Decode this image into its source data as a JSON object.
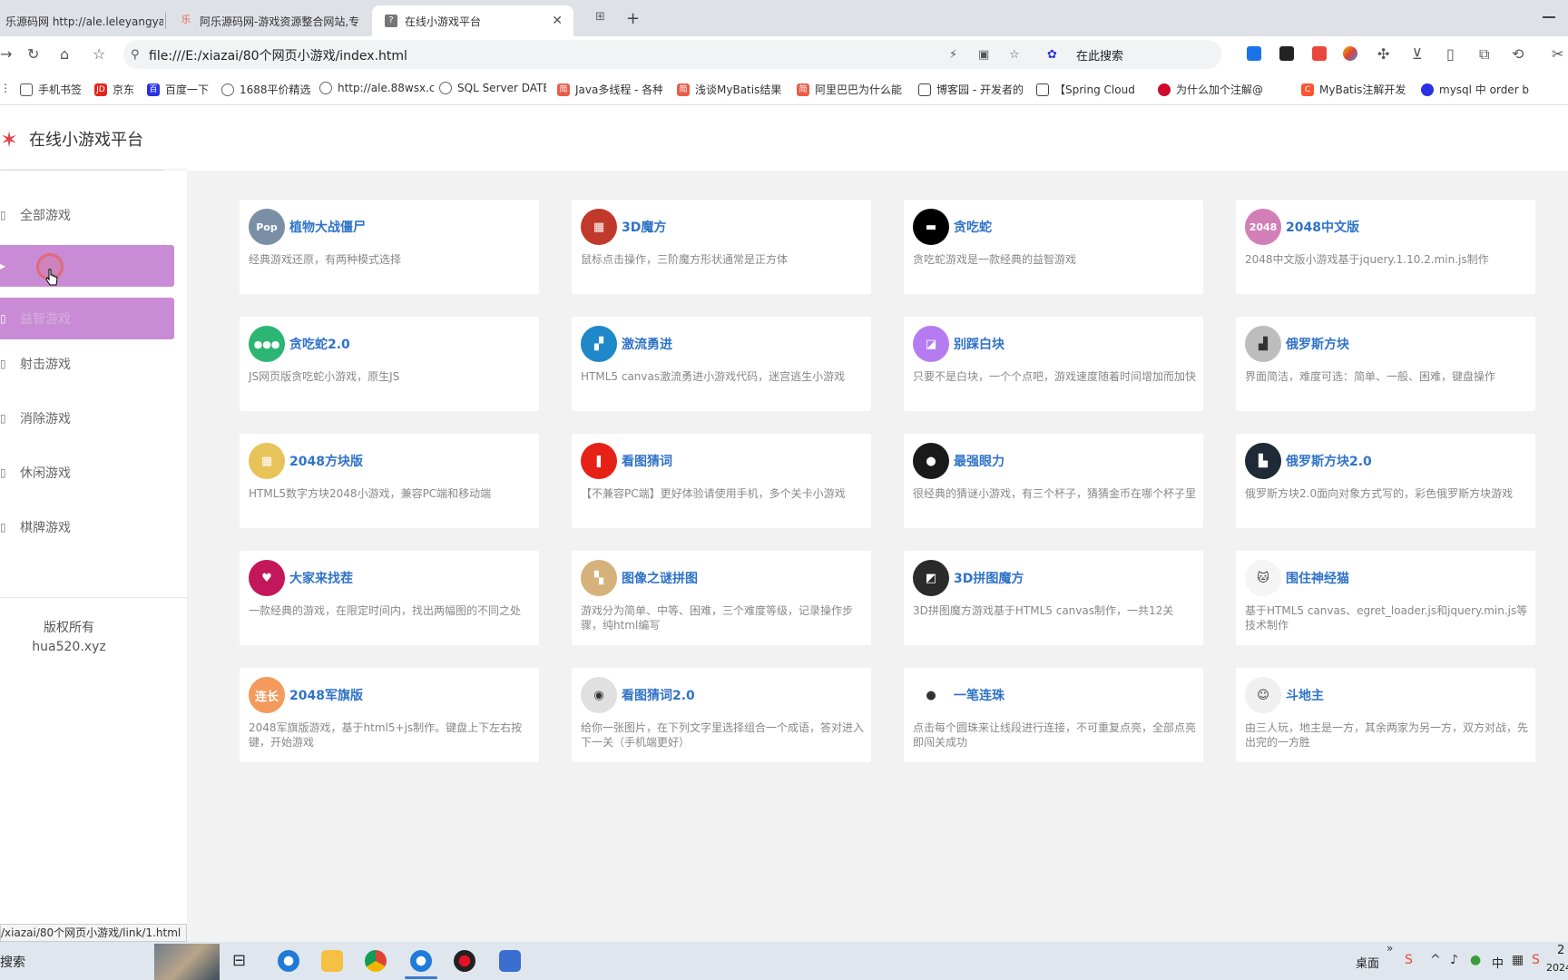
{
  "browser": {
    "tabs": [
      {
        "label": "乐源码网 http://ale.leleyangya"
      },
      {
        "label": "阿乐源码网-游戏资源整合网站,专"
      },
      {
        "label": "在线小游戏平台",
        "close": "✕"
      }
    ],
    "new_tab": "+",
    "address": "file:///E:/xiazai/80个网页小游戏/index.html",
    "search_placeholder": "在此搜索",
    "bookmarks": [
      {
        "label": "手机书签",
        "color": "#ffffff",
        "mark": ""
      },
      {
        "label": "京东",
        "color": "#e1251b",
        "mark": "JD"
      },
      {
        "label": "百度一下",
        "color": "#2932e1",
        "mark": "百"
      },
      {
        "label": "1688平价精选",
        "color": "#666666",
        "mark": ""
      },
      {
        "label": "http://ale.88wsx.c",
        "color": "#666666",
        "mark": ""
      },
      {
        "label": "SQL Server DATE",
        "color": "#666666",
        "mark": ""
      },
      {
        "label": "Java多线程 - 各种",
        "color": "#e85d4a",
        "mark": "简"
      },
      {
        "label": "浅谈MyBatis结果",
        "color": "#e85d4a",
        "mark": "简"
      },
      {
        "label": "阿里巴巴为什么能",
        "color": "#e85d4a",
        "mark": "简"
      },
      {
        "label": "博客园 - 开发者的",
        "color": "#444444",
        "mark": ""
      },
      {
        "label": "【Spring Cloud",
        "color": "#444444",
        "mark": ""
      },
      {
        "label": "为什么加个注解@",
        "color": "#cf0a2c",
        "mark": ""
      },
      {
        "label": "MyBatis注解开发",
        "color": "#fc5531",
        "mark": "C"
      },
      {
        "label": "mysql 中 order b",
        "color": "#2932e1",
        "mark": ""
      }
    ]
  },
  "site": {
    "title": "在线小游戏平台",
    "nav": [
      {
        "label": "全部游戏",
        "icon": "▯"
      },
      {
        "label": "",
        "icon": "▸"
      },
      {
        "label": "益智游戏",
        "icon": "▯"
      },
      {
        "label": "射击游戏",
        "icon": "▯"
      },
      {
        "label": "消除游戏",
        "icon": "▯"
      },
      {
        "label": "休闲游戏",
        "icon": "▯"
      },
      {
        "label": "棋牌游戏",
        "icon": "▯"
      }
    ],
    "copyright": "版权所有",
    "domain": "hua520.xyz"
  },
  "games": [
    {
      "name": "植物大战僵尸",
      "desc": "经典游戏还原，有两种模式选择",
      "color": "#7a8fa6",
      "mark": "Pop"
    },
    {
      "name": "3D魔方",
      "desc": "鼠标点击操作，三阶魔方形状通常是正方体",
      "color": "#c0392b",
      "mark": "▦"
    },
    {
      "name": "贪吃蛇",
      "desc": "贪吃蛇游戏是一款经典的益智游戏",
      "color": "#000000",
      "mark": "▬"
    },
    {
      "name": "2048中文版",
      "desc": "2048中文版小游戏基于jquery.1.10.2.min.js制作",
      "color": "#d27fb8",
      "mark": "2048"
    },
    {
      "name": "贪吃蛇2.0",
      "desc": "JS网页版贪吃蛇小游戏，原生JS",
      "color": "#2bb673",
      "mark": "●●●"
    },
    {
      "name": "激流勇进",
      "desc": "HTML5 canvas激流勇进小游戏代码，迷宫逃生小游戏",
      "color": "#1e88c8",
      "mark": "▞"
    },
    {
      "name": "别踩白块",
      "desc": "只要不是白块，一个个点吧，游戏速度随着时间增加而加快",
      "color": "#b57cf2",
      "mark": "◪"
    },
    {
      "name": "俄罗斯方块",
      "desc": "界面简洁，难度可选：简单、一般、困难，键盘操作",
      "color": "#bdbdbd",
      "mark": "▟"
    },
    {
      "name": "2048方块版",
      "desc": "HTML5数字方块2048小游戏，兼容PC端和移动端",
      "color": "#e8c35a",
      "mark": "▦"
    },
    {
      "name": "看图猜词",
      "desc": "【不兼容PC端】更好体验请使用手机，多个关卡小游戏",
      "color": "#e62117",
      "mark": "❚"
    },
    {
      "name": "最强眼力",
      "desc": "很经典的猜谜小游戏，有三个杯子，猜猜金币在哪个杯子里",
      "color": "#1a1a1a",
      "mark": "●"
    },
    {
      "name": "俄罗斯方块2.0",
      "desc": "俄罗斯方块2.0面向对象方式写的，彩色俄罗斯方块游戏",
      "color": "#1f2a36",
      "mark": "▙"
    },
    {
      "name": "大家来找茬",
      "desc": "一款经典的游戏，在限定时间内，找出两幅图的不同之处",
      "color": "#c2185b",
      "mark": "♥"
    },
    {
      "name": "图像之谜拼图",
      "desc": "游戏分为简单、中等、困难，三个难度等级，记录操作步骤，纯html编写",
      "color": "#d4b27a",
      "mark": "▚"
    },
    {
      "name": "3D拼图魔方",
      "desc": "3D拼图魔方游戏基于HTML5 canvas制作，一共12关",
      "color": "#2b2b2b",
      "mark": "◩"
    },
    {
      "name": "围住神经猫",
      "desc": "基于HTML5 canvas、egret_loader.js和jquery.min.js等技术制作",
      "color": "#f5f5f5",
      "mark": "🐱"
    },
    {
      "name": "2048军旗版",
      "desc": "2048军旗版游戏，基于html5+js制作。键盘上下左右按键，开始游戏",
      "color": "#f39a5c",
      "mark": "连长"
    },
    {
      "name": "看图猜词2.0",
      "desc": "给你一张图片，在下列文字里选择组合一个成语，答对进入下一关（手机端更好）",
      "color": "#e0e0e0",
      "mark": "◉"
    },
    {
      "name": "一笔连珠",
      "desc": "点击每个圆珠来让线段进行连接，不可重复点亮，全部点亮即闯关成功",
      "color": "#ffffff",
      "mark": "●"
    },
    {
      "name": "斗地主",
      "desc": "由三人玩，地主是一方，其余两家为另一方，双方对战，先出完的一方胜",
      "color": "#f0f0f0",
      "mark": "☺"
    }
  ],
  "status_url": "/xiazai/80个网页小游戏/link/1.html",
  "taskbar": {
    "search": "搜索",
    "desktop": "桌面",
    "ime": "中",
    "clock_top": "2",
    "clock_bottom": "2024"
  }
}
